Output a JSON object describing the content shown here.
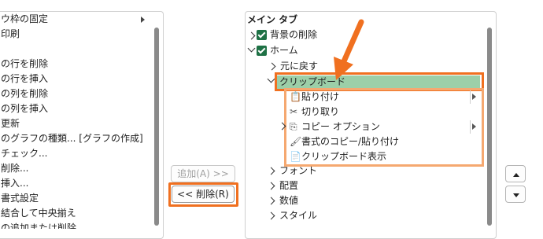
{
  "left_list": {
    "items": [
      {
        "label": "ウ枠の固定",
        "has_submenu": true
      },
      {
        "label": "印刷",
        "has_submenu": false
      },
      {
        "label": "",
        "has_submenu": false
      },
      {
        "label": "の行を削除",
        "has_submenu": false
      },
      {
        "label": "の行を挿入",
        "has_submenu": false
      },
      {
        "label": "の列を削除",
        "has_submenu": false
      },
      {
        "label": "の列を挿入",
        "has_submenu": false
      },
      {
        "label": "更新",
        "has_submenu": false
      },
      {
        "label": "のグラフの種類... [グラフの作成]",
        "has_submenu": false
      },
      {
        "label": "チェック...",
        "has_submenu": false
      },
      {
        "label": "削除...",
        "has_submenu": false
      },
      {
        "label": "挿入...",
        "has_submenu": false
      },
      {
        "label": "書式設定",
        "has_submenu": false
      },
      {
        "label": "結合して中央揃え",
        "has_submenu": false
      },
      {
        "label": "の追加または削除",
        "has_submenu": false
      }
    ]
  },
  "buttons": {
    "add_label": "追加(A) >>",
    "remove_label": "<< 削除(R)",
    "move_up_icon": "triangle-up-icon",
    "move_down_icon": "triangle-down-icon"
  },
  "tree": {
    "header": "メイン タブ",
    "items": [
      {
        "label": "背景の削除",
        "checked": true,
        "expander": "right",
        "level": 0
      },
      {
        "label": "ホーム",
        "checked": true,
        "expander": "down",
        "level": 0
      },
      {
        "label": "元に戻す",
        "expander": "right",
        "level": 1
      },
      {
        "label": "クリップボード",
        "expander": "down",
        "level": 1,
        "selected": true
      },
      {
        "label": "貼り付け",
        "icon": "paste-icon",
        "level": 2,
        "has_submenu": true
      },
      {
        "label": "切り取り",
        "icon": "scissors-icon",
        "level": 2
      },
      {
        "label": "コピー オプション",
        "icon": "copy-icon",
        "expander": "right",
        "level": 2,
        "has_submenu": true
      },
      {
        "label": "書式のコピー/貼り付け",
        "icon": "format-painter-icon",
        "level": 2
      },
      {
        "label": "クリップボード表示",
        "icon": "clipboard-icon",
        "level": 2
      },
      {
        "label": "フォント",
        "expander": "right",
        "level": 1
      },
      {
        "label": "配置",
        "expander": "right",
        "level": 1
      },
      {
        "label": "数値",
        "expander": "right",
        "level": 1
      },
      {
        "label": "スタイル",
        "expander": "right",
        "level": 1
      }
    ]
  },
  "colors": {
    "highlight_orange": "#f07020",
    "light_orange": "#f5a870",
    "selection_green": "#9ccfa8",
    "checkbox_green": "#1e7145"
  }
}
